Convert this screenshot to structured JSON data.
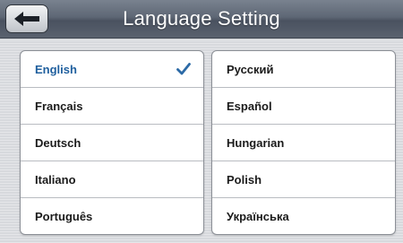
{
  "header": {
    "title": "Language Setting"
  },
  "icons": {
    "back": "left-arrow-icon",
    "selected": "check-icon"
  },
  "colors": {
    "selected_text": "#1f5f9e",
    "check": "#2c6aa6"
  },
  "languages": {
    "left": [
      {
        "label": "English",
        "selected": true
      },
      {
        "label": "Français",
        "selected": false
      },
      {
        "label": "Deutsch",
        "selected": false
      },
      {
        "label": "Italiano",
        "selected": false
      },
      {
        "label": "Português",
        "selected": false
      }
    ],
    "right": [
      {
        "label": "Русский",
        "selected": false
      },
      {
        "label": "Español",
        "selected": false
      },
      {
        "label": "Hungarian",
        "selected": false
      },
      {
        "label": "Polish",
        "selected": false
      },
      {
        "label": "Українська",
        "selected": false
      }
    ]
  }
}
